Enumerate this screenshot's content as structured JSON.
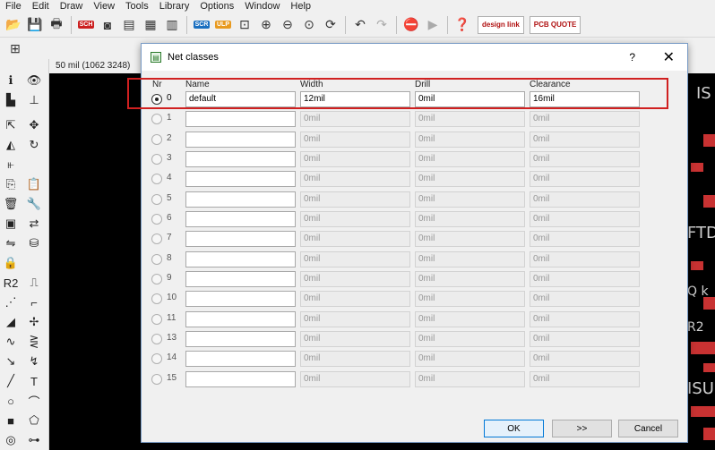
{
  "menu": [
    "File",
    "Edit",
    "Draw",
    "View",
    "Tools",
    "Library",
    "Options",
    "Window",
    "Help"
  ],
  "toolbar": {
    "scr_label": "SCR",
    "ulp_label": "ULP",
    "design_link_label": "design link",
    "pcb_quote_label": "PCB QUOTE"
  },
  "status": {
    "coordinate": "50 mil (1062 3248)"
  },
  "canvas_labels": [
    "IS",
    "FTD",
    "Q k",
    "R2",
    "ISU"
  ],
  "dialog": {
    "title": "Net classes",
    "help": "?",
    "close": "✕",
    "headers": {
      "nr": "Nr",
      "name": "Name",
      "width": "Width",
      "drill": "Drill",
      "clearance": "Clearance"
    },
    "rows": [
      {
        "nr": "0",
        "name": "default",
        "width": "12mil",
        "drill": "0mil",
        "clearance": "16mil"
      },
      {
        "nr": "1",
        "name": "",
        "width": "0mil",
        "drill": "0mil",
        "clearance": "0mil"
      },
      {
        "nr": "2",
        "name": "",
        "width": "0mil",
        "drill": "0mil",
        "clearance": "0mil"
      },
      {
        "nr": "3",
        "name": "",
        "width": "0mil",
        "drill": "0mil",
        "clearance": "0mil"
      },
      {
        "nr": "4",
        "name": "",
        "width": "0mil",
        "drill": "0mil",
        "clearance": "0mil"
      },
      {
        "nr": "5",
        "name": "",
        "width": "0mil",
        "drill": "0mil",
        "clearance": "0mil"
      },
      {
        "nr": "6",
        "name": "",
        "width": "0mil",
        "drill": "0mil",
        "clearance": "0mil"
      },
      {
        "nr": "7",
        "name": "",
        "width": "0mil",
        "drill": "0mil",
        "clearance": "0mil"
      },
      {
        "nr": "8",
        "name": "",
        "width": "0mil",
        "drill": "0mil",
        "clearance": "0mil"
      },
      {
        "nr": "9",
        "name": "",
        "width": "0mil",
        "drill": "0mil",
        "clearance": "0mil"
      },
      {
        "nr": "10",
        "name": "",
        "width": "0mil",
        "drill": "0mil",
        "clearance": "0mil"
      },
      {
        "nr": "11",
        "name": "",
        "width": "0mil",
        "drill": "0mil",
        "clearance": "0mil"
      },
      {
        "nr": "13",
        "name": "",
        "width": "0mil",
        "drill": "0mil",
        "clearance": "0mil"
      },
      {
        "nr": "14",
        "name": "",
        "width": "0mil",
        "drill": "0mil",
        "clearance": "0mil"
      },
      {
        "nr": "15",
        "name": "",
        "width": "0mil",
        "drill": "0mil",
        "clearance": "0mil"
      }
    ],
    "buttons": {
      "ok": "OK",
      "next": ">>",
      "cancel": "Cancel"
    }
  },
  "colors": {
    "highlight": "#d02020",
    "canvas": "#000000",
    "pad": "#c83232"
  }
}
